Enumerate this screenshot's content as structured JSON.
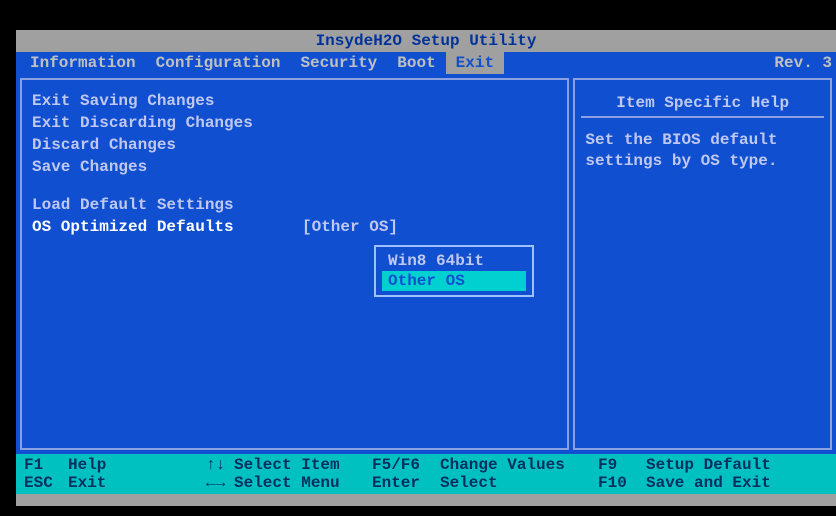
{
  "title": "InsydeH2O Setup Utility",
  "revision": "Rev. 3",
  "menu": {
    "items": [
      "Information",
      "Configuration",
      "Security",
      "Boot",
      "Exit"
    ],
    "active_index": 4
  },
  "left": {
    "items": [
      {
        "label": "Exit Saving Changes"
      },
      {
        "label": "Exit Discarding Changes"
      },
      {
        "label": "Discard Changes"
      },
      {
        "label": "Save Changes"
      }
    ],
    "items2": [
      {
        "label": "Load Default Settings"
      },
      {
        "label": "OS Optimized Defaults",
        "value": "[Other OS]",
        "selected": true
      }
    ]
  },
  "popup": {
    "options": [
      "Win8 64bit",
      "Other OS"
    ],
    "selected_index": 1
  },
  "help": {
    "title": "Item Specific Help",
    "body": "Set the BIOS default settings by OS type."
  },
  "footer": {
    "rows": [
      [
        {
          "key": "F1",
          "action": "Help"
        },
        {
          "key": "↑↓",
          "action": "Select Item"
        },
        {
          "key": "F5/F6",
          "action": "Change Values"
        },
        {
          "key": "F9",
          "action": "Setup Default"
        }
      ],
      [
        {
          "key": "ESC",
          "action": "Exit"
        },
        {
          "key": "←→",
          "action": "Select Menu"
        },
        {
          "key": "Enter",
          "action": "Select"
        },
        {
          "key": "F10",
          "action": "Save and Exit"
        }
      ]
    ]
  }
}
